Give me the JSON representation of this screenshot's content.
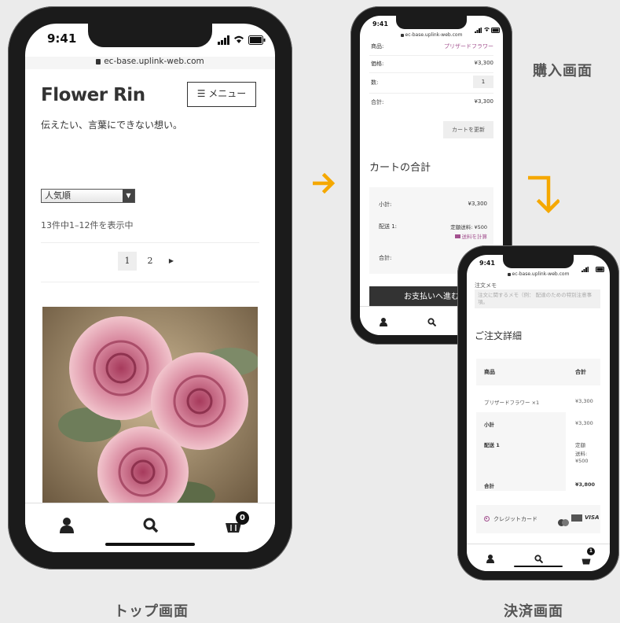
{
  "phones": {
    "top": {
      "time": "9:41",
      "url": "ec-base.uplink-web.com",
      "site_title": "Flower Rin",
      "tagline": "伝えたい、言葉にできない想い。",
      "menu_label": "メニュー",
      "sort_value": "人気順",
      "result_count": "13件中1–12件を表示中",
      "pages": [
        "1",
        "2"
      ],
      "cart_count": "0"
    },
    "purchase": {
      "time": "9:41",
      "url": "ec-base.uplink-web.com",
      "rows": [
        {
          "label": "商品:",
          "value": "プリザードフラワー"
        },
        {
          "label": "価格:",
          "value": "¥3,300"
        },
        {
          "label": "数:",
          "value": "1"
        },
        {
          "label": "合計:",
          "value": "¥3,300"
        }
      ],
      "update_cart": "カートを更新",
      "cart_totals_title": "カートの合計",
      "subtotal_label": "小計:",
      "subtotal_value": "¥3,300",
      "shipping_label": "配送 1:",
      "shipping_value": "定額送料: ¥500",
      "shipping_calc": "送料を計算",
      "total_label": "合計:",
      "checkout_button": "お支払いへ進む"
    },
    "checkout": {
      "time": "9:41",
      "url": "ec-base.uplink-web.com",
      "memo_label": "注文メモ",
      "memo_placeholder": "注文に関するメモ（例： 配達のための特別注意事項。",
      "order_details_title": "ご注文詳細",
      "th_product": "商品",
      "th_total": "合計",
      "item_name": "プリザードフラワー ×1",
      "item_price": "¥3,300",
      "subtotal_label": "小計",
      "subtotal_value": "¥3,300",
      "shipping_label": "配送 1",
      "shipping_value_1": "定額",
      "shipping_value_2": "送料:",
      "shipping_value_3": "¥500",
      "total_label": "合計",
      "total_value": "¥3,800",
      "payment_label": "クレジットカード",
      "visa": "VISA",
      "cart_count": "1"
    }
  },
  "captions": {
    "purchase": "購入画面",
    "top": "トップ画面",
    "checkout": "決済画面"
  },
  "colors": {
    "accent_arrow": "#f5a800",
    "link_purple": "#a3518f",
    "dark_button": "#333333"
  }
}
